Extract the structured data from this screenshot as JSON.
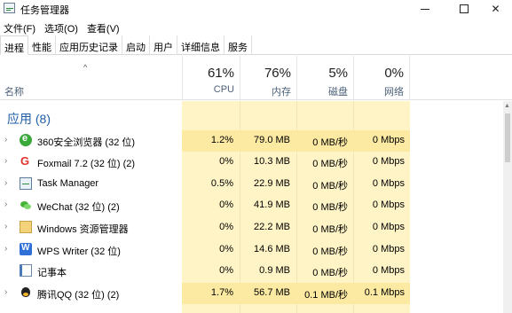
{
  "window": {
    "title": "任务管理器",
    "icon": "task-manager-icon",
    "controls": [
      "minimize",
      "maximize",
      "close"
    ]
  },
  "menu": [
    "文件(F)",
    "选项(O)",
    "查看(V)"
  ],
  "tabs": [
    "进程",
    "性能",
    "应用历史记录",
    "启动",
    "用户",
    "详细信息",
    "服务"
  ],
  "active_tab": "进程",
  "header": {
    "name_label": "名称",
    "sort_indicator": "^",
    "columns": [
      {
        "percent": "61%",
        "label": "CPU"
      },
      {
        "percent": "76%",
        "label": "内存"
      },
      {
        "percent": "5%",
        "label": "磁盘"
      },
      {
        "percent": "0%",
        "label": "网络"
      }
    ]
  },
  "group": {
    "title": "应用 (8)"
  },
  "rows": [
    {
      "name": "360安全浏览器 (32 位)",
      "icon": "360-browser-icon",
      "cpu": "1.2%",
      "mem": "79.0 MB",
      "disk": "0 MB/秒",
      "net": "0 Mbps",
      "expandable": true
    },
    {
      "name": "Foxmail 7.2 (32 位) (2)",
      "icon": "foxmail-icon",
      "cpu": "0%",
      "mem": "10.3 MB",
      "disk": "0 MB/秒",
      "net": "0 Mbps",
      "expandable": true
    },
    {
      "name": "Task Manager",
      "icon": "task-manager-icon",
      "cpu": "0.5%",
      "mem": "22.9 MB",
      "disk": "0 MB/秒",
      "net": "0 Mbps",
      "expandable": true
    },
    {
      "name": "WeChat (32 位) (2)",
      "icon": "wechat-icon",
      "cpu": "0%",
      "mem": "41.9 MB",
      "disk": "0 MB/秒",
      "net": "0 Mbps",
      "expandable": true
    },
    {
      "name": "Windows 资源管理器",
      "icon": "windows-explorer-icon",
      "cpu": "0%",
      "mem": "22.2 MB",
      "disk": "0 MB/秒",
      "net": "0 Mbps",
      "expandable": true
    },
    {
      "name": "WPS Writer (32 位)",
      "icon": "wps-writer-icon",
      "cpu": "0%",
      "mem": "14.6 MB",
      "disk": "0 MB/秒",
      "net": "0 Mbps",
      "expandable": true
    },
    {
      "name": "记事本",
      "icon": "notepad-icon",
      "cpu": "0%",
      "mem": "0.9 MB",
      "disk": "0 MB/秒",
      "net": "0 Mbps",
      "expandable": false
    },
    {
      "name": "腾讯QQ (32 位) (2)",
      "icon": "qq-icon",
      "cpu": "1.7%",
      "mem": "56.7 MB",
      "disk": "0.1 MB/秒",
      "net": "0.1 Mbps",
      "expandable": true
    }
  ],
  "colors": {
    "usage_bg": "#fff4c6",
    "usage_highlight": "#fce9a2",
    "group_title": "#1f5fa6",
    "header_label": "#4c6079"
  }
}
